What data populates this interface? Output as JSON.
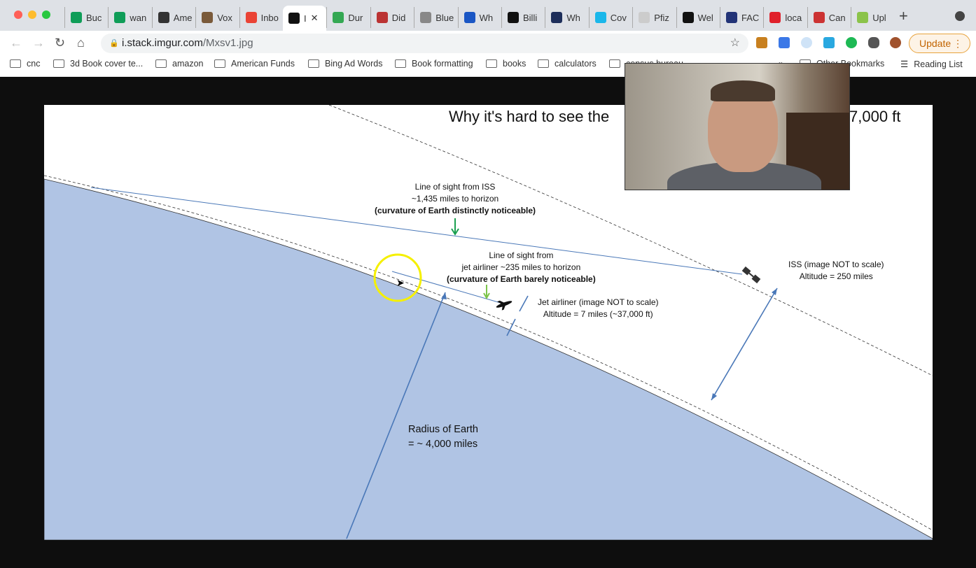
{
  "browser": {
    "tabs": [
      {
        "label": "Buc",
        "color": "#0f9d58"
      },
      {
        "label": "wan",
        "color": "#0f9d58"
      },
      {
        "label": "Ame",
        "color": "#333"
      },
      {
        "label": "Vox",
        "color": "#7a5a3a"
      },
      {
        "label": "Inbo",
        "color": "#ea4335"
      },
      {
        "label": "I",
        "color": "#111",
        "active": true
      },
      {
        "label": "Dur",
        "color": "#34a853"
      },
      {
        "label": "Did",
        "color": "#b33"
      },
      {
        "label": "Blue",
        "color": "#888"
      },
      {
        "label": "Wh",
        "color": "#1a56c4"
      },
      {
        "label": "Billi",
        "color": "#111"
      },
      {
        "label": "Wh",
        "color": "#1d2e5a"
      },
      {
        "label": "Cov",
        "color": "#1ab7ea"
      },
      {
        "label": "Pfiz",
        "color": "#ccc"
      },
      {
        "label": "Wel",
        "color": "#111"
      },
      {
        "label": "FAC",
        "color": "#223377"
      },
      {
        "label": "loca",
        "color": "#e0202b"
      },
      {
        "label": "Can",
        "color": "#c33"
      },
      {
        "label": "Upl",
        "color": "#8bc34a"
      }
    ],
    "close_tab_glyph": "✕",
    "new_tab_glyph": "+",
    "url_host": "i.stack.imgur.com",
    "url_path": "/Mxsv1.jpg",
    "update_label": "Update",
    "bookmarks": [
      "cnc",
      "3d Book cover te...",
      "amazon",
      "American Funds",
      "Bing Ad Words",
      "Book formatting",
      "books",
      "calculators",
      "census bureau"
    ],
    "more_bookmarks": "»",
    "other_bookmarks": "Other Bookmarks",
    "reading_list": "Reading List"
  },
  "diagram": {
    "title_left": "Why it's hard to see the",
    "title_right": "7,000 ft",
    "iss_los": [
      "Line of sight from ISS",
      "~1,435 miles to horizon",
      "(curvature of Earth distinctly noticeable)"
    ],
    "jet_los": [
      "Line of sight from",
      "jet airliner ~235 miles to horizon",
      "(curvature of Earth barely noticeable)"
    ],
    "jet_label": [
      "Jet airliner (image NOT to scale)",
      "Altitude = 7 miles (~37,000 ft)"
    ],
    "iss_label": [
      "ISS (image NOT to scale)",
      "Altitude = 250 miles"
    ],
    "radius_label": [
      "Radius of Earth",
      "= ~ 4,000 miles"
    ],
    "colors": {
      "earth": "#b0c4e4",
      "line": "#4a78b8",
      "green_arrow": "#1aa050",
      "light_green_arrow": "#7cc44a",
      "highlight": "#f5f000"
    }
  }
}
